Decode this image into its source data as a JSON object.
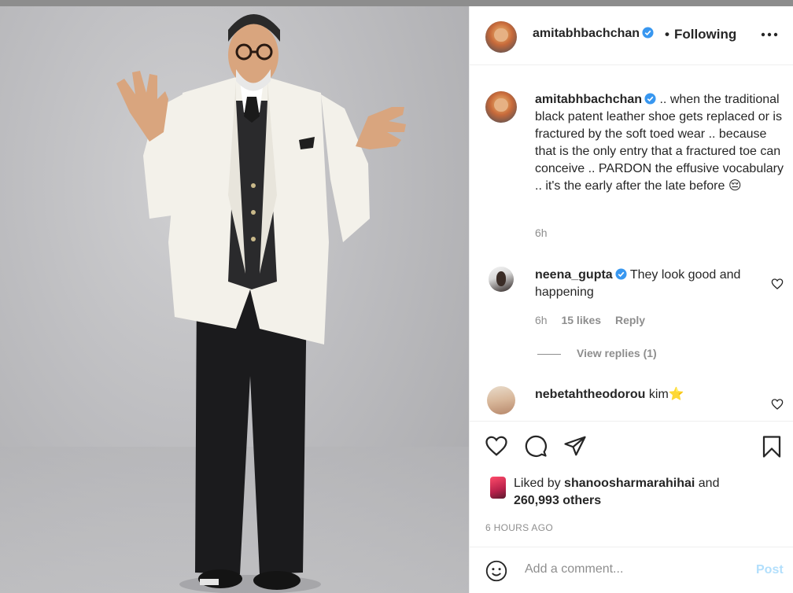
{
  "photo": {
    "alt_subject": "man in white tuxedo jacket"
  },
  "header": {
    "username": "amitabhbachchan",
    "separator": "•",
    "follow_state": "Following",
    "more_icon": "ellipsis-icon"
  },
  "caption": {
    "username": "amitabhbachchan",
    "text": ".. when the traditional black patent leather shoe gets replaced or is fractured by the soft toed wear .. because that is the only entry that a fractured toe can conceive .. PARDON the effusive vocabulary .. it's the early after the late before",
    "emoji": "😔",
    "time": "6h"
  },
  "comments": [
    {
      "username": "neena_gupta",
      "verified": true,
      "text": "They look good and happening",
      "time": "6h",
      "likes": "15 likes",
      "reply": "Reply",
      "view_replies": "View replies (1)"
    },
    {
      "username": "nebetahtheodorou",
      "verified": false,
      "text": "kim⭐"
    }
  ],
  "actions": {
    "icons": [
      "heart-icon",
      "comment-icon",
      "share-icon",
      "bookmark-icon"
    ],
    "liked_by_prefix": "Liked by",
    "liked_by_user": "shanoosharmarahihai",
    "liked_by_and": "and",
    "liked_by_count": "260,993 others",
    "time_ago": "6 HOURS AGO"
  },
  "comment_box": {
    "placeholder": "Add a comment...",
    "post_label": "Post",
    "emoji_icon": "smiley-icon"
  },
  "colors": {
    "verified_blue": "#3897f0",
    "post_disabled": "#b2dffc",
    "muted_text": "#8e8e8e"
  }
}
